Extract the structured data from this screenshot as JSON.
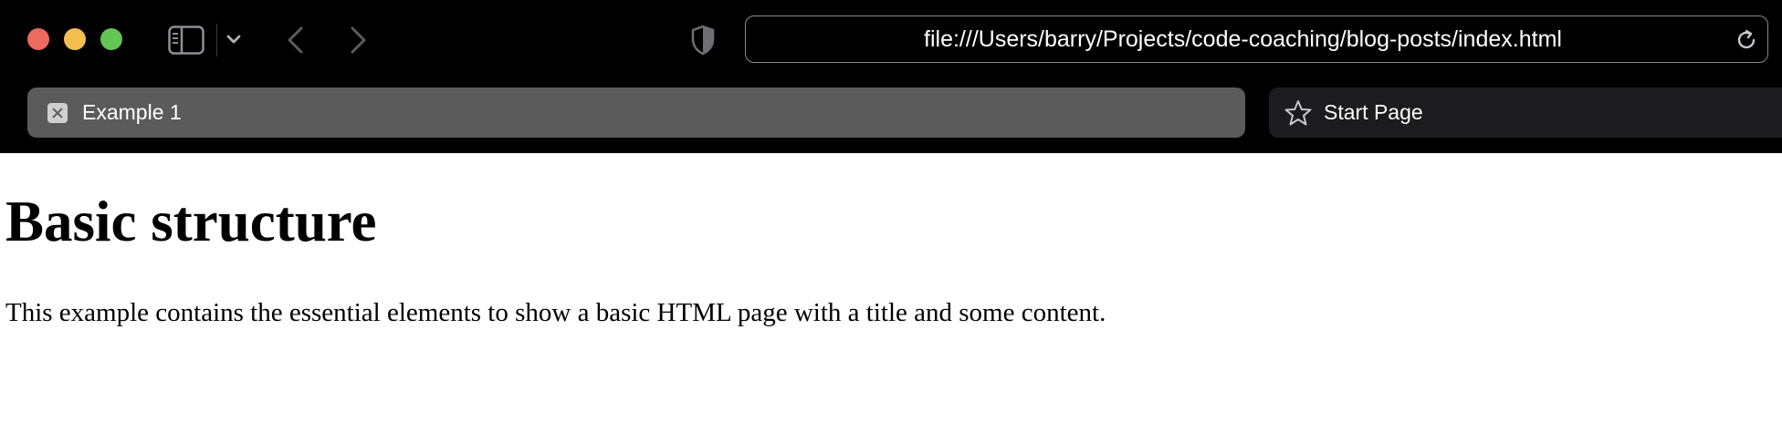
{
  "browser": {
    "address_bar": {
      "url": "file:///Users/barry/Projects/code-coaching/blog-posts/index.html"
    },
    "toolbar_icons": [
      "sidebar-icon",
      "chevron-down-icon",
      "back-arrow-icon",
      "forward-arrow-icon",
      "privacy-shield-icon",
      "reload-icon"
    ],
    "tabs": [
      {
        "label": "Example 1",
        "active": true,
        "icon": "close-icon"
      },
      {
        "label": "Start Page",
        "active": false,
        "icon": "star-icon"
      }
    ],
    "colors": {
      "close": "#ed6a5e",
      "minimize": "#f5bf4f",
      "maximize": "#62c554",
      "chrome_bg": "#000000",
      "active_tab": "#5b5b5b",
      "inactive_tab": "#1c1c1e"
    }
  },
  "page": {
    "heading": "Basic structure",
    "paragraph": "This example contains the essential elements to show a basic HTML page with a title and some content."
  }
}
